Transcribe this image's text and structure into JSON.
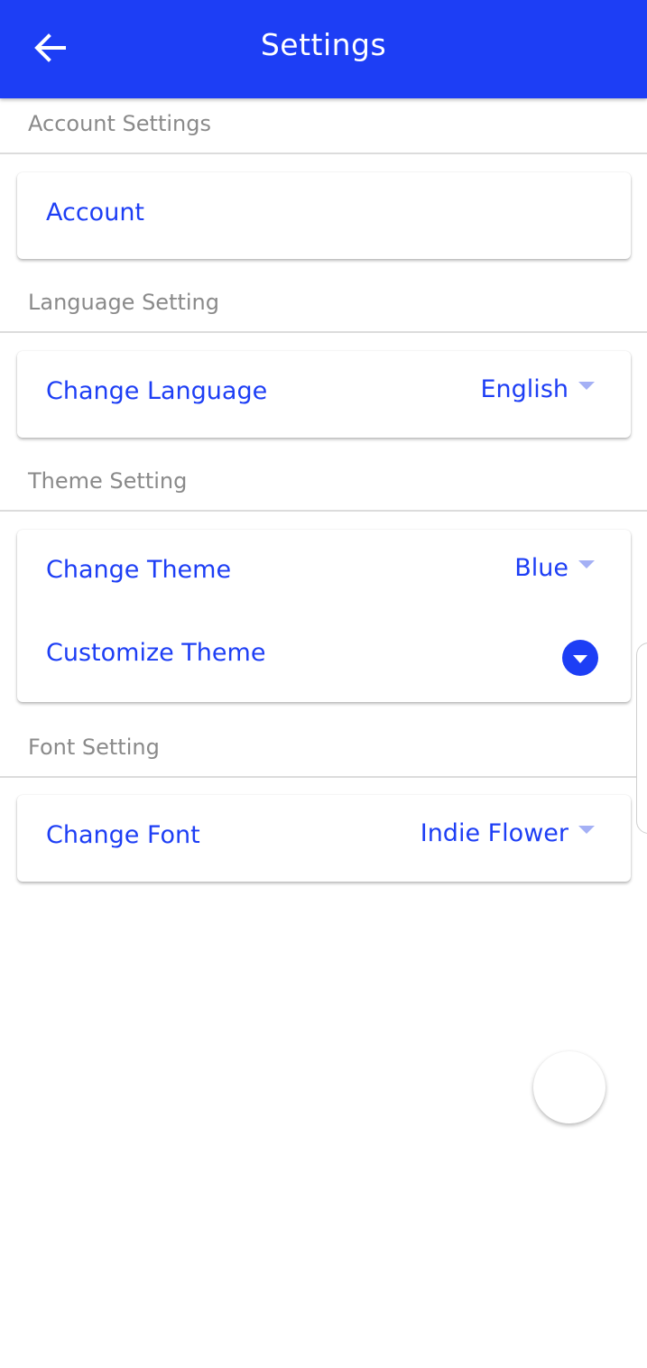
{
  "app_bar": {
    "title": "Settings",
    "back_icon": "arrow-left-icon",
    "color": "#1d3ef5"
  },
  "sections": {
    "account": {
      "header": "Account Settings",
      "row_label": "Account"
    },
    "language": {
      "header": "Language Setting",
      "row_label": "Change Language",
      "selected": "English"
    },
    "theme": {
      "header": "Theme Setting",
      "row_label": "Change Theme",
      "selected": "Blue",
      "customize_label": "Customize Theme",
      "customize_icon": "expand-circle-icon"
    },
    "font": {
      "header": "Font Setting",
      "row_label": "Change Font",
      "selected": "Indie Flower"
    }
  },
  "colors": {
    "accent": "#1d3ef5",
    "section_header_text": "#8a8a8a",
    "caret": "#a4b0f5"
  }
}
